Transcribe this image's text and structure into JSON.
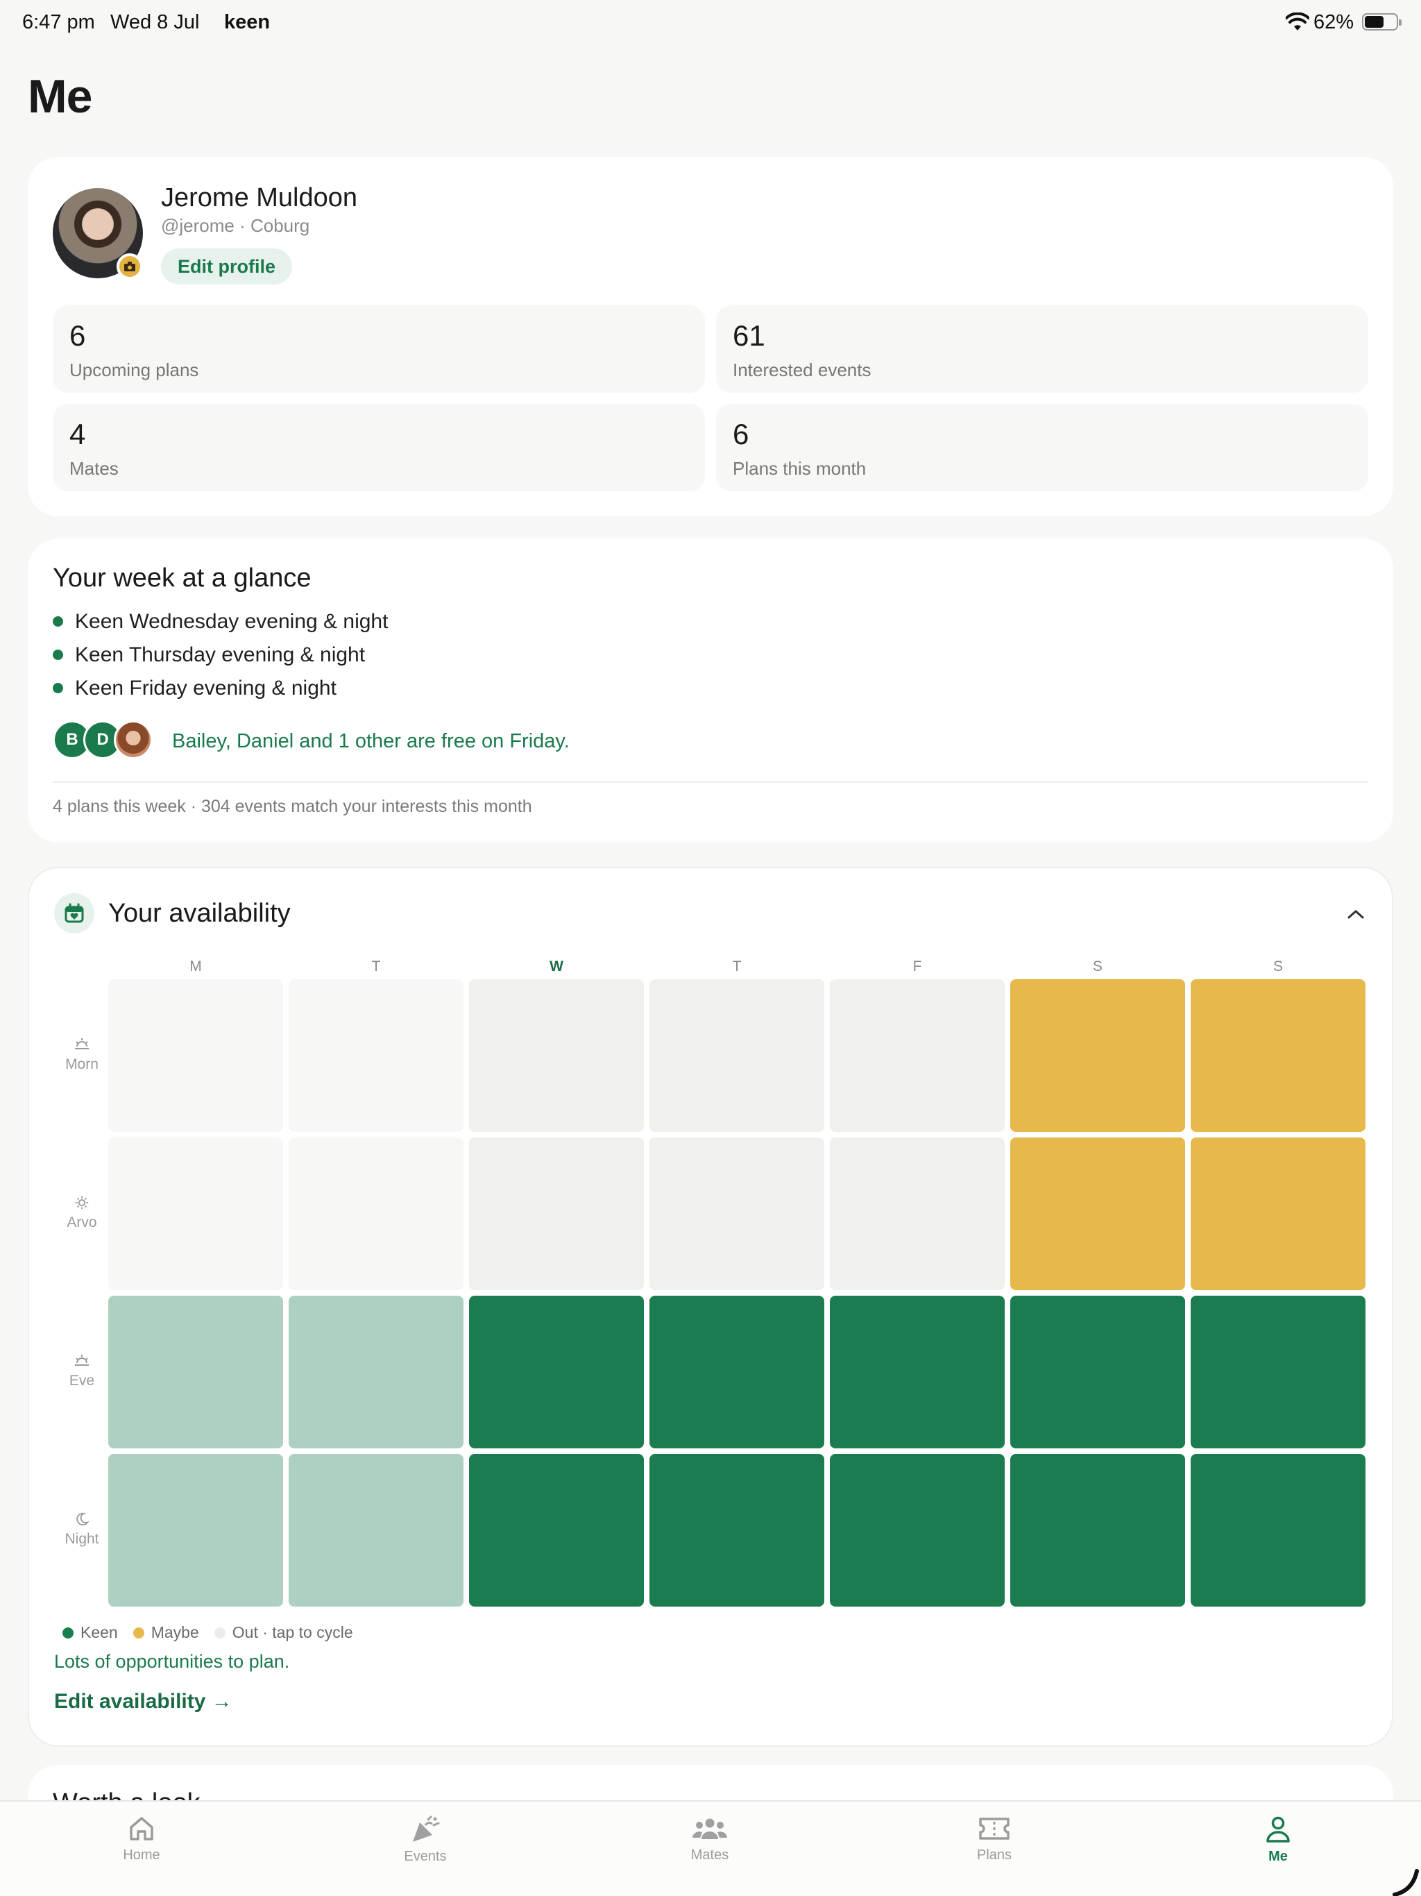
{
  "status_bar": {
    "time": "6:47 pm",
    "date": "Wed 8 Jul",
    "app": "keen",
    "battery": "62%",
    "battery_level": 0.62
  },
  "page_title": "Me",
  "profile": {
    "name": "Jerome Muldoon",
    "handle_location": "@jerome · Coburg",
    "edit_label": "Edit profile",
    "stats": [
      {
        "value": "6",
        "label": "Upcoming plans"
      },
      {
        "value": "61",
        "label": "Interested events"
      },
      {
        "value": "4",
        "label": "Mates"
      },
      {
        "value": "6",
        "label": "Plans this month"
      }
    ]
  },
  "week": {
    "title": "Your week at a glance",
    "items": [
      "Keen Wednesday evening & night",
      "Keen Thursday evening & night",
      "Keen Friday evening & night"
    ],
    "mates": [
      {
        "initial": "B",
        "color": "#1a7a4c"
      },
      {
        "initial": "D",
        "color": "#1a7a4c"
      },
      {
        "initial": "",
        "color": "#c98a6a"
      }
    ],
    "mates_text": "Bailey, Daniel and 1 other are free on Friday.",
    "footer": "4 plans this week · 304 events match your interests this month"
  },
  "availability": {
    "title": "Your availability",
    "days": [
      "M",
      "T",
      "W",
      "T",
      "F",
      "S",
      "S"
    ],
    "today_index": 2,
    "slots": [
      "Morn",
      "Arvo",
      "Eve",
      "Night"
    ],
    "grid": [
      [
        "past",
        "past",
        "out",
        "out",
        "out",
        "maybe",
        "maybe"
      ],
      [
        "past",
        "past",
        "out",
        "out",
        "out",
        "maybe",
        "maybe"
      ],
      [
        "keen-past",
        "keen-past",
        "keen",
        "keen",
        "keen",
        "keen",
        "keen"
      ],
      [
        "keen-past",
        "keen-past",
        "keen",
        "keen",
        "keen",
        "keen",
        "keen"
      ]
    ],
    "colors": {
      "keen": "#1b7d4f",
      "keen-past": "#aed0c0",
      "maybe": "#e7b84b",
      "out": "#f0f0ec",
      "past": "#f7f7f5"
    },
    "legend": {
      "keen": "Keen",
      "maybe": "Maybe",
      "out": "Out · tap to cycle"
    },
    "note": "Lots of opportunities to plan.",
    "edit_label": "Edit availability →"
  },
  "next_section": {
    "title": "Worth a look"
  },
  "tabs": [
    {
      "label": "Home",
      "icon": "home-icon",
      "active": false
    },
    {
      "label": "Events",
      "icon": "party-popper-icon",
      "active": false
    },
    {
      "label": "Mates",
      "icon": "people-icon",
      "active": false
    },
    {
      "label": "Plans",
      "icon": "ticket-icon",
      "active": false
    },
    {
      "label": "Me",
      "icon": "person-icon",
      "active": true
    }
  ],
  "accent": "#1a7a4c"
}
